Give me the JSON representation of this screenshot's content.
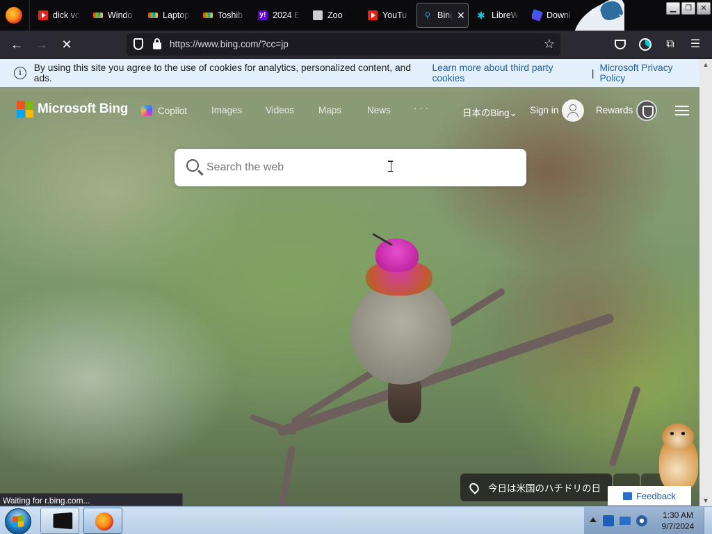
{
  "browser": {
    "tabs": [
      {
        "title": "dick vc",
        "favicon": "youtube-icon"
      },
      {
        "title": "Windo",
        "favicon": "windows-icon"
      },
      {
        "title": "Laptop",
        "favicon": "windows-icon"
      },
      {
        "title": "Toshib",
        "favicon": "windows-icon"
      },
      {
        "title": "2024 E",
        "favicon": "yahoo-icon"
      },
      {
        "title": "Zoo",
        "favicon": "document-icon"
      },
      {
        "title": "YouTu",
        "favicon": "youtube-icon"
      },
      {
        "title": "Bing",
        "favicon": "bing-icon",
        "active": true
      },
      {
        "title": "LibreW",
        "favicon": "librewolf-icon"
      },
      {
        "title": "Downl",
        "favicon": "download-icon"
      }
    ],
    "new_tab_label": "+",
    "tab_list_label": "⌄",
    "url": "https://www.bing.com/?cc=jp",
    "status_text": "Waiting for r.bing.com..."
  },
  "cookie_banner": {
    "text": "By using this site you agree to the use of cookies for analytics, personalized content, and ads.",
    "link1": "Learn more about third party cookies",
    "separator": "|",
    "link2": "Microsoft Privacy Policy"
  },
  "bing": {
    "logo_text": "Microsoft Bing",
    "nav": {
      "copilot": "Copilot",
      "images": "Images",
      "videos": "Videos",
      "maps": "Maps",
      "news": "News",
      "more": "· · ·"
    },
    "region": "日本のBing",
    "sign_in": "Sign in",
    "rewards": "Rewards",
    "search_placeholder": "Search the web",
    "image_caption": "今日は米国のハチドリの日",
    "feedback": "Feedback"
  },
  "taskbar": {
    "time": "1:30 AM",
    "date": "9/7/2024"
  },
  "colors": {
    "browser_bg": "#1c1b22",
    "cookie_bg": "#e3f0fb",
    "link": "#1a5fa0"
  }
}
